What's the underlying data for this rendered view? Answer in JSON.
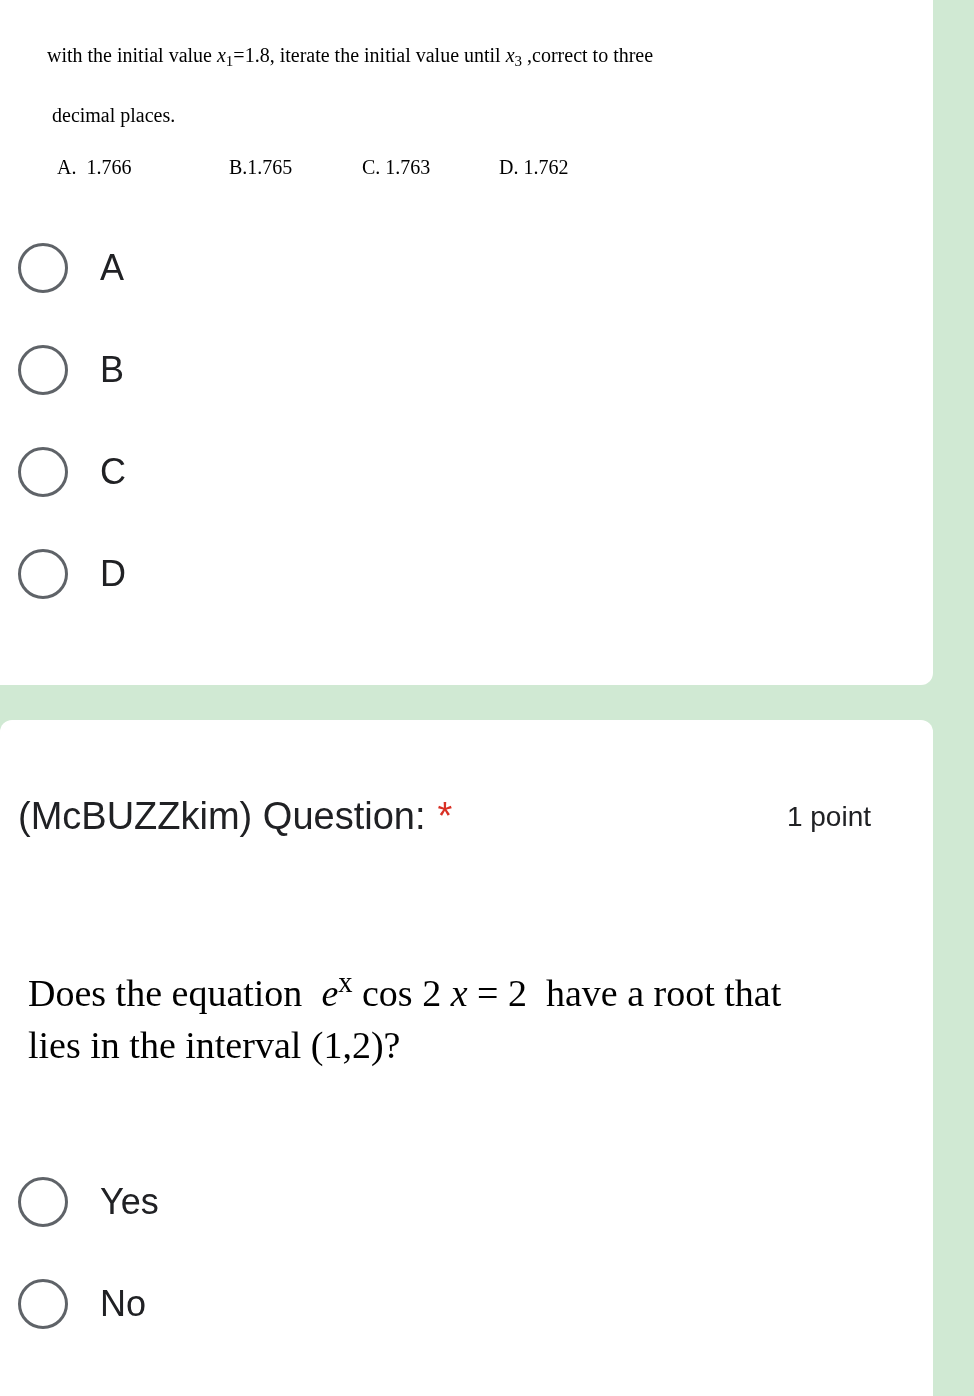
{
  "previous_question": {
    "lines": [
      "with the initial value *x*$_{1}$=1.8, iterate the initial value until *x*$_{3}$ ,correct to three",
      "decimal places."
    ],
    "choices": [
      "A.  1.766",
      "B.1.765",
      "C. 1.763",
      "D. 1.762"
    ],
    "options": [
      {
        "label": "A",
        "selected": false
      },
      {
        "label": "B",
        "selected": false
      },
      {
        "label": "C",
        "selected": false
      },
      {
        "label": "D",
        "selected": false
      }
    ]
  },
  "question": {
    "title": "(McBUZZkim) Question:",
    "required_mark": "*",
    "points": "1 point",
    "text_lines": [
      "Does the equation  *e*$^{x}$ cos 2 *x* = 2  have a root that",
      "lies in the interval (1,2)?"
    ],
    "options": [
      {
        "label": "Yes",
        "selected": false
      },
      {
        "label": "No",
        "selected": false
      }
    ]
  }
}
